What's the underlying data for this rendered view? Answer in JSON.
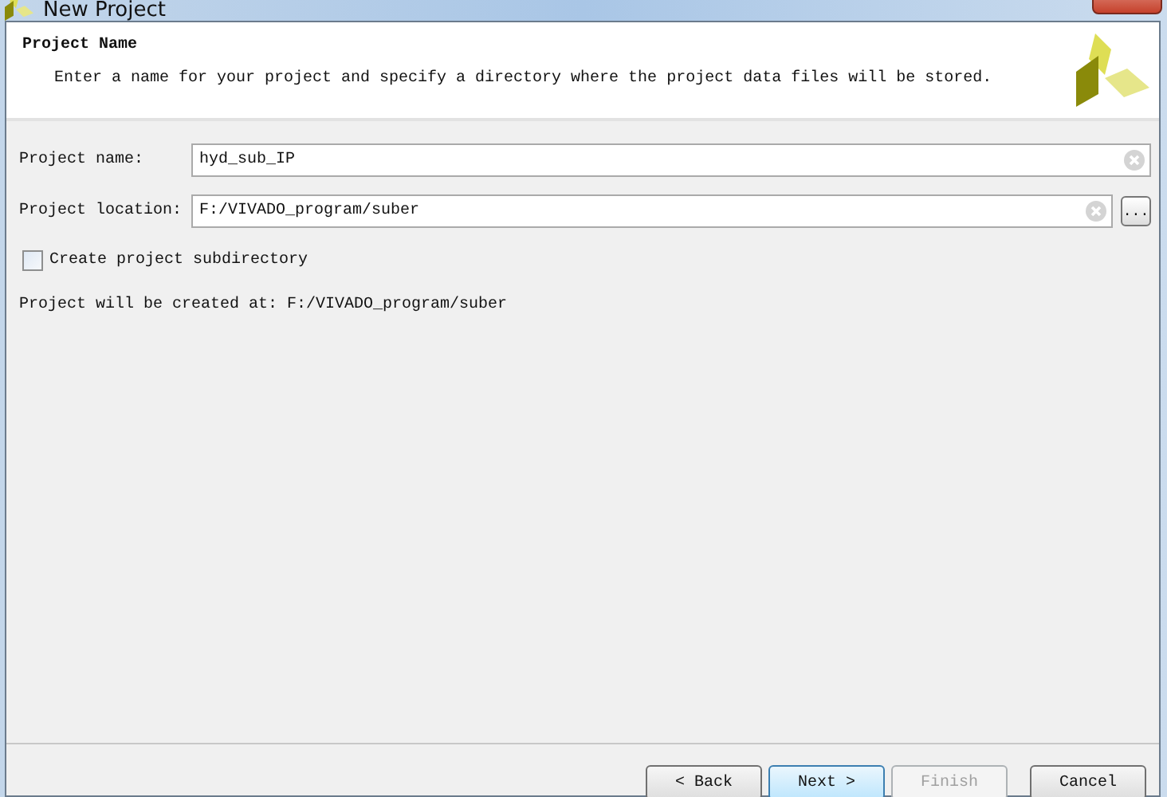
{
  "window": {
    "title": "New Project"
  },
  "header": {
    "title": "Project Name",
    "description": "Enter a name for your project and specify a directory where the project data files will be stored."
  },
  "fields": [
    {
      "label": "Project name:",
      "value": "hyd_sub_IP",
      "browse": false
    },
    {
      "label": "Project location:",
      "value": "F:/VIVADO_program/suber",
      "browse": true,
      "browse_label": "..."
    }
  ],
  "subdirectory": {
    "label": "Create project subdirectory",
    "checked": false
  },
  "summary": "Project will be created at: F:/VIVADO_program/suber",
  "buttons": [
    {
      "label": "< Back",
      "disabled": false,
      "default": false
    },
    {
      "label": "Next >",
      "disabled": false,
      "default": true
    },
    {
      "label": "Finish",
      "disabled": true,
      "default": false
    },
    {
      "label": "Cancel",
      "disabled": false,
      "default": false
    }
  ]
}
